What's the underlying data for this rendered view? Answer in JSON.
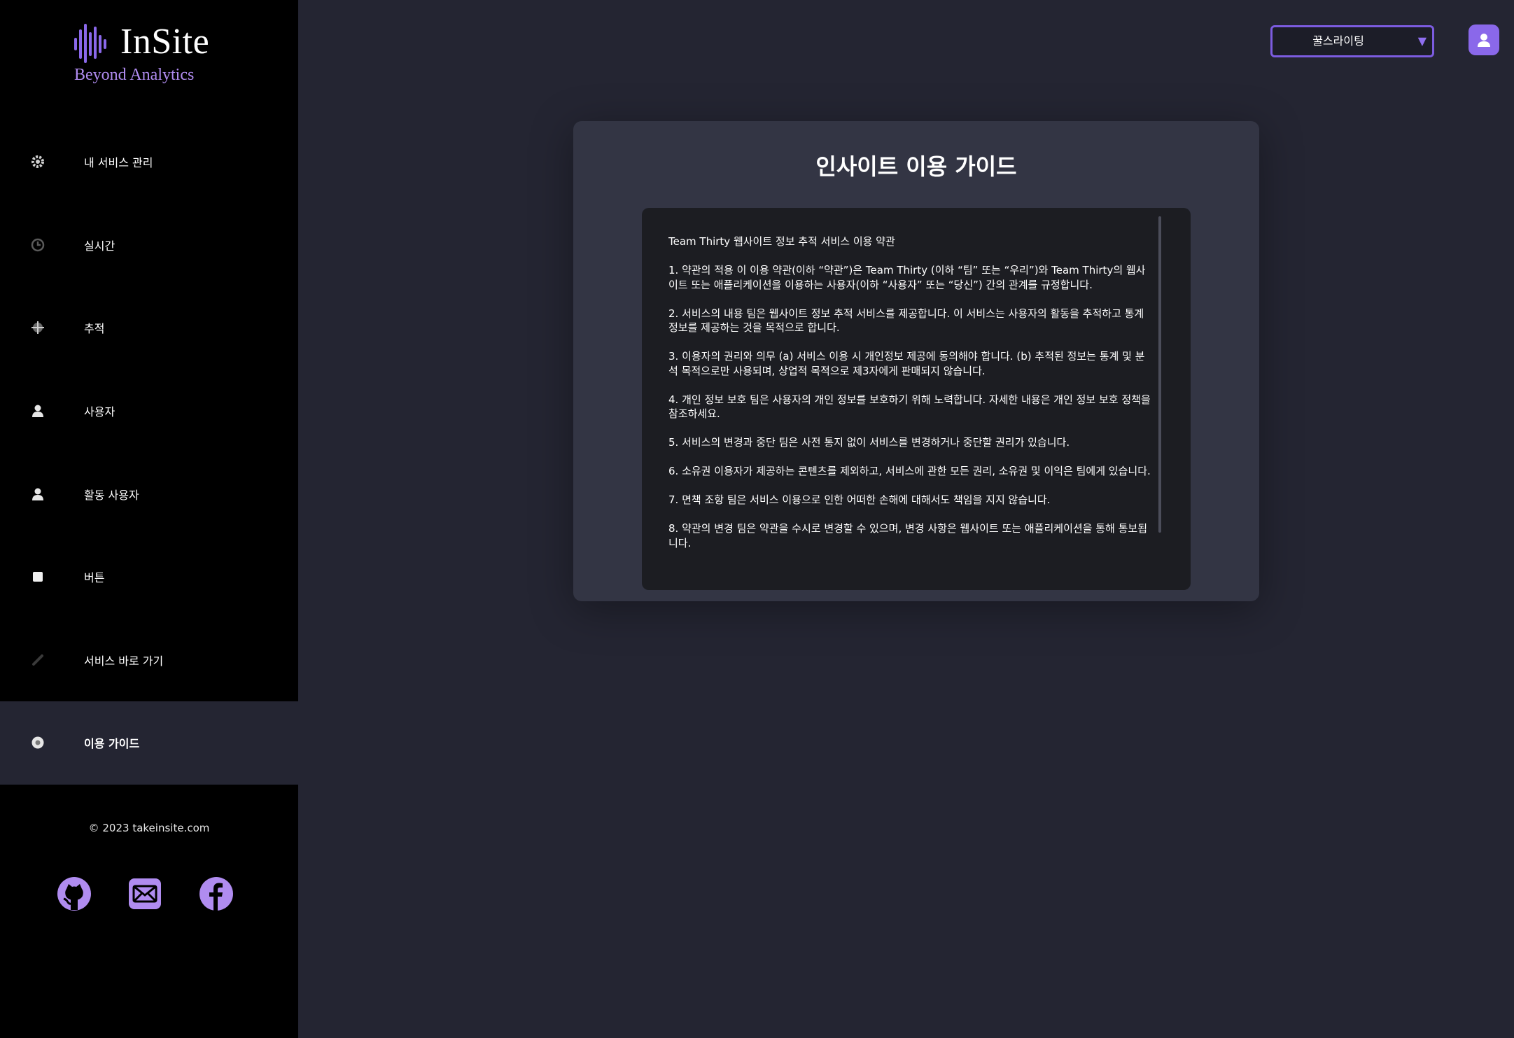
{
  "brand": {
    "title": "InSite",
    "subtitle": "Beyond Analytics",
    "accent": "#8a68ea"
  },
  "sidebar": {
    "items": [
      {
        "label": "내 서비스 관리",
        "icon": "gear-icon"
      },
      {
        "label": "실시간",
        "icon": "clock-icon"
      },
      {
        "label": "추적",
        "icon": "crosshair-icon"
      },
      {
        "label": "사용자",
        "icon": "user-icon"
      },
      {
        "label": "활동 사용자",
        "icon": "active-user-icon"
      },
      {
        "label": "버튼",
        "icon": "button-icon"
      },
      {
        "label": "서비스 바로 가기",
        "icon": "link-icon"
      },
      {
        "label": "이용 가이드",
        "icon": "info-icon",
        "active": true
      }
    ],
    "copyright": "© 2023 takeinsite.com",
    "social": [
      "github-icon",
      "mail-icon",
      "facebook-icon"
    ]
  },
  "topbar": {
    "service_select": "꿀스라이팅",
    "profile_icon": "user-icon"
  },
  "guide": {
    "title": "인사이트 이용 가이드",
    "paragraphs": [
      "Team Thirty 웹사이트 정보 추적 서비스 이용 약관",
      "1. 약관의 적용 이 이용 약관(이하 “약관”)은 Team Thirty (이하 “팀” 또는 “우리”)와 Team Thirty의 웹사이트 또는 애플리케이션을 이용하는 사용자(이하 “사용자” 또는 “당신”) 간의 관계를 규정합니다.",
      "2. 서비스의 내용 팀은 웹사이트 정보 추적 서비스를 제공합니다. 이 서비스는 사용자의 활동을 추적하고 통계 정보를 제공하는 것을 목적으로 합니다.",
      "3. 이용자의 권리와 의무 (a) 서비스 이용 시 개인정보 제공에 동의해야 합니다. (b) 추적된 정보는 통계 및 분석 목적으로만 사용되며, 상업적 목적으로 제3자에게 판매되지 않습니다.",
      "4. 개인 정보 보호 팀은 사용자의 개인 정보를 보호하기 위해 노력합니다. 자세한 내용은 개인 정보 보호 정책을 참조하세요.",
      "5. 서비스의 변경과 중단 팀은 사전 통지 없이 서비스를 변경하거나 중단할 권리가 있습니다.",
      "6. 소유권 이용자가 제공하는 콘텐츠를 제외하고, 서비스에 관한 모든 권리, 소유권 및 이익은 팀에게 있습니다.",
      "7. 면책 조항 팀은 서비스 이용으로 인한 어떠한 손해에 대해서도 책임을 지지 않습니다.",
      "8. 약관의 변경 팀은 약관을 수시로 변경할 수 있으며, 변경 사항은 웹사이트 또는 애플리케이션을 통해 통보됩니다."
    ]
  }
}
